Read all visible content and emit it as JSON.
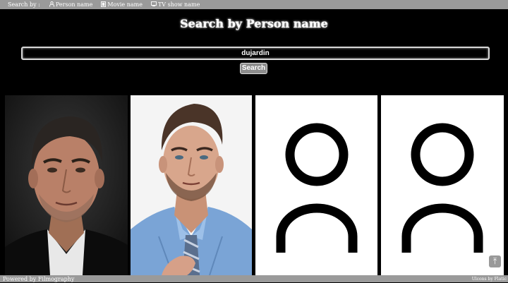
{
  "nav": {
    "label": "Search by :",
    "links": [
      {
        "label": "Person name",
        "icon": "person-icon"
      },
      {
        "label": "Movie name",
        "icon": "film-icon"
      },
      {
        "label": "TV show name",
        "icon": "tv-icon"
      }
    ]
  },
  "header": {
    "title": "Search by Person name"
  },
  "search": {
    "value": "dujardin",
    "button_label": "Search"
  },
  "results": [
    {
      "type": "photo",
      "description": "portrait-man-dark-background"
    },
    {
      "type": "photo",
      "description": "portrait-man-blue-shirt"
    },
    {
      "type": "placeholder",
      "icon": "person-placeholder-icon"
    },
    {
      "type": "placeholder",
      "icon": "person-placeholder-icon"
    }
  ],
  "footer": {
    "powered_by": "Powered by Filmography",
    "credits": "Ulcons by Flatic"
  },
  "back_to_top": {
    "glyph": "⤒",
    "icon": "arrow-up-to-top-icon"
  },
  "colors": {
    "bar_bg": "#9a9a9a",
    "page_bg": "#000000",
    "placeholder_bg": "#ffffff"
  }
}
